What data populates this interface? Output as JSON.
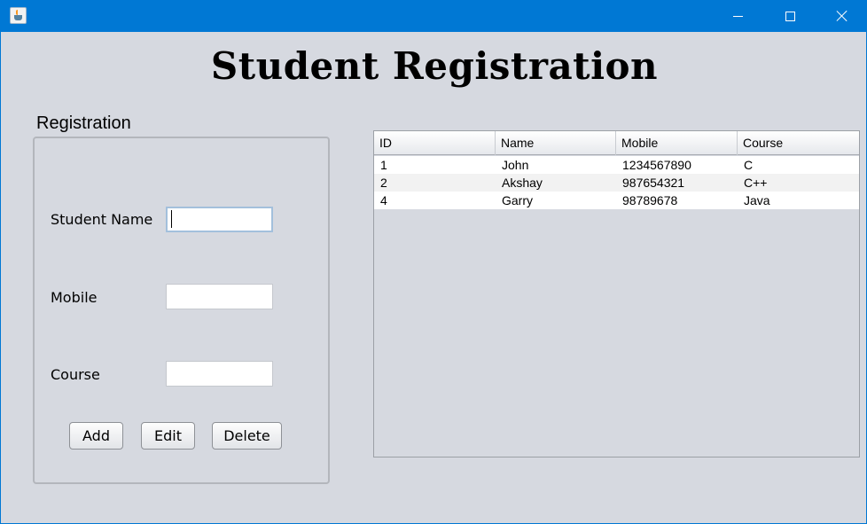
{
  "window": {
    "title": "",
    "icons": {
      "app": "java-cup-icon",
      "minimize": "minimize-icon",
      "maximize": "maximize-icon",
      "close": "close-icon"
    },
    "colors": {
      "titlebar": "#0078d4",
      "background": "#d6d9e0"
    }
  },
  "heading": "Student Registration",
  "form": {
    "group_title": "Registration",
    "name_label": "Student Name",
    "name_value": "",
    "mobile_label": "Mobile",
    "mobile_value": "",
    "course_label": "Course",
    "course_value": "",
    "buttons": {
      "add": "Add",
      "edit": "Edit",
      "delete": "Delete"
    }
  },
  "table": {
    "columns": [
      "ID",
      "Name",
      "Mobile",
      "Course"
    ],
    "rows": [
      [
        "1",
        "John",
        "1234567890",
        "C"
      ],
      [
        "2",
        "Akshay",
        "987654321",
        "C++"
      ],
      [
        "4",
        "Garry",
        "98789678",
        "Java"
      ]
    ]
  }
}
